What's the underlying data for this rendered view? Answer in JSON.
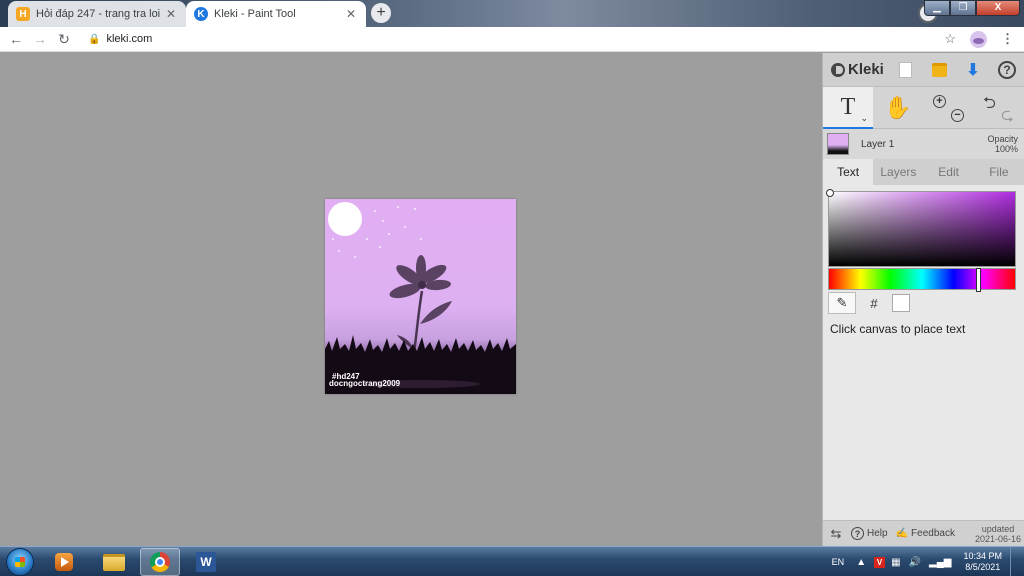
{
  "browser": {
    "tabs": [
      {
        "title": "Hỏi đáp 247 - trang tra loi",
        "favicon": "H",
        "active": false
      },
      {
        "title": "Kleki - Paint Tool",
        "favicon": "K",
        "active": true
      }
    ],
    "new_tab_label": "+",
    "url": "kleki.com",
    "window_close": "X"
  },
  "canvas": {
    "signature_line1": "#hd247",
    "signature_line2": "docngoctrang2009",
    "colors": {
      "sky_top": "#e2aef3",
      "ground": "#110811",
      "moon": "#ffffff",
      "flower": "#5a4263"
    }
  },
  "panel": {
    "app_name": "Kleki",
    "active_tool_glyph": "T",
    "layer_name": "Layer 1",
    "opacity_label": "Opacity",
    "opacity_value": "100%",
    "tabs": [
      "Text",
      "Layers",
      "Edit",
      "File"
    ],
    "active_tab": "Text",
    "hex_button": "#",
    "hint": "Click canvas to place text",
    "help_label": "Help",
    "feedback_label": "Feedback",
    "updated_label": "updated",
    "updated_date": "2021-06-16",
    "accent": "#1e78e0"
  },
  "taskbar": {
    "lang": "EN",
    "time": "10:34 PM",
    "date": "8/5/2021",
    "word_label": "W"
  }
}
